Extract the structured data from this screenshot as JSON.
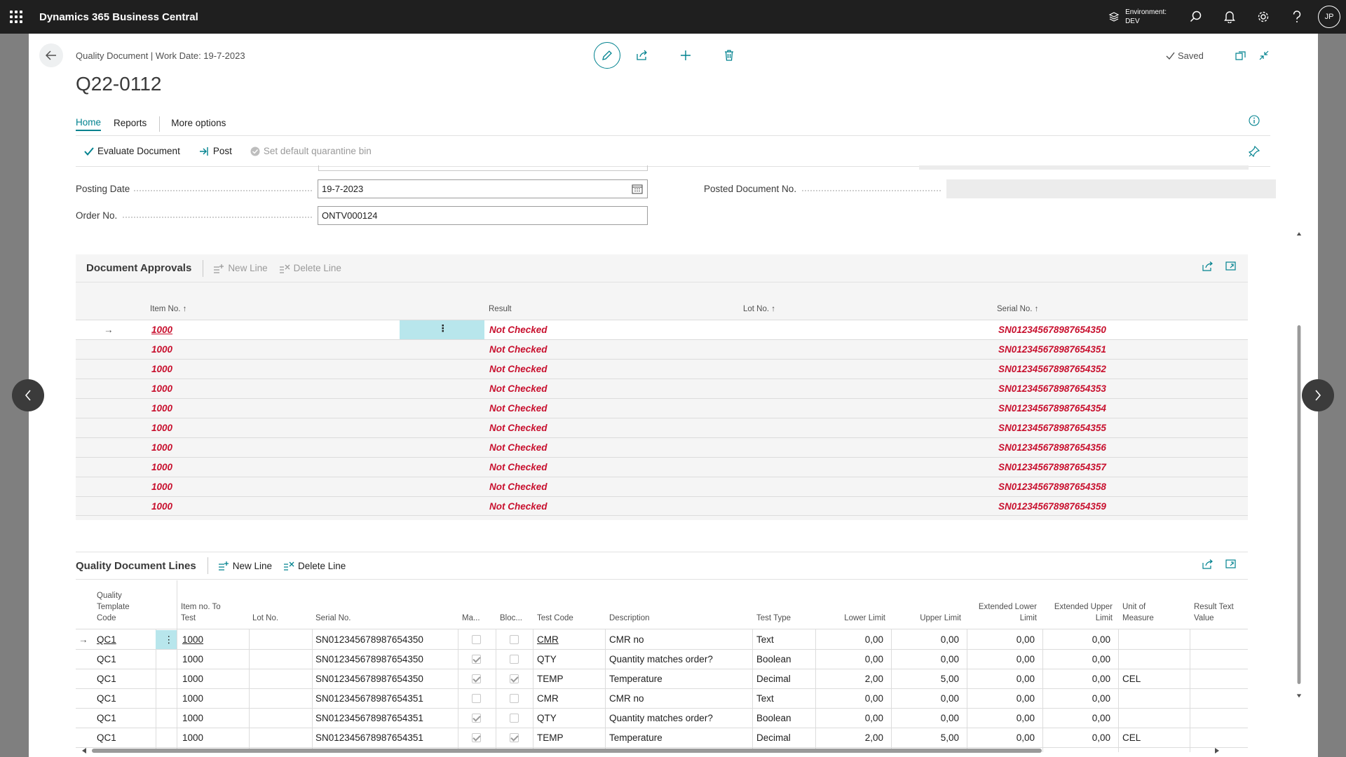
{
  "app": {
    "title": "Dynamics 365 Business Central",
    "environment_label": "Environment:",
    "environment_value": "DEV",
    "user_initials": "JP"
  },
  "page": {
    "breadcrumb": "Quality Document | Work Date: 19-7-2023",
    "title": "Q22-0112",
    "saved_label": "Saved",
    "tabs": [
      "Home",
      "Reports",
      "More options"
    ],
    "actions": {
      "evaluate": "Evaluate Document",
      "post": "Post",
      "quarantine": "Set default quarantine bin"
    }
  },
  "fields": {
    "posting_date_label": "Posting Date",
    "posting_date_value": "19-7-2023",
    "order_no_label": "Order No.",
    "order_no_value": "ONTV000124",
    "posted_doc_label": "Posted Document No.",
    "posted_doc_value": ""
  },
  "approvals": {
    "title": "Document Approvals",
    "new_line": "New Line",
    "delete_line": "Delete Line",
    "columns": [
      "Item No. ↑",
      "Result",
      "Lot No. ↑",
      "Serial No. ↑"
    ],
    "rows": [
      {
        "item": "1000",
        "result": "Not Checked",
        "lot": "",
        "serial": "SN01234567898765435O"
      },
      {
        "item": "1000",
        "result": "Not Checked",
        "lot": "",
        "serial": "SN01234567898765435​1"
      },
      {
        "item": "1000",
        "result": "Not Checked",
        "lot": "",
        "serial": "SN01234567898765435​2"
      },
      {
        "item": "1000",
        "result": "Not Checked",
        "lot": "",
        "serial": "SN01234567898765435​3"
      },
      {
        "item": "1000",
        "result": "Not Checked",
        "lot": "",
        "serial": "SN01234567898765435​4"
      },
      {
        "item": "1000",
        "result": "Not Checked",
        "lot": "",
        "serial": "SN01234567898765435​5"
      },
      {
        "item": "1000",
        "result": "Not Checked",
        "lot": "",
        "serial": "SN01234567898765435​6"
      },
      {
        "item": "1000",
        "result": "Not Checked",
        "lot": "",
        "serial": "SN01234567898765435​7"
      },
      {
        "item": "1000",
        "result": "Not Checked",
        "lot": "",
        "serial": "SN01234567898765435​8"
      },
      {
        "item": "1000",
        "result": "Not Checked",
        "lot": "",
        "serial": "SN01234567898765435​9"
      }
    ]
  },
  "lines": {
    "title": "Quality Document Lines",
    "new_line": "New Line",
    "delete_line": "Delete Line",
    "columns": {
      "template": [
        "Quality",
        "Template",
        "Code"
      ],
      "item": [
        "Item no. To",
        "Test"
      ],
      "lot": "Lot No.",
      "serial": "Serial No.",
      "ma": "Ma...",
      "bloc": "Bloc...",
      "test_code": "Test Code",
      "description": "Description",
      "test_type": "Test Type",
      "lower": "Lower Limit",
      "upper": "Upper Limit",
      "ext_lower": [
        "Extended Lower",
        "Limit"
      ],
      "ext_upper": [
        "Extended Upper",
        "Limit"
      ],
      "uom": [
        "Unit of",
        "Measure"
      ],
      "result_text": "Result Text Value"
    },
    "rows": [
      {
        "template": "QC1",
        "item": "1000",
        "lot": "",
        "serial": "SN012345678987654350",
        "ma": false,
        "bloc": false,
        "test_code": "CMR",
        "description": "CMR no",
        "test_type": "Text",
        "lower": "0,00",
        "upper": "0,00",
        "ext_lower": "0,00",
        "ext_upper": "0,00",
        "uom": "",
        "result_text": ""
      },
      {
        "template": "QC1",
        "item": "1000",
        "lot": "",
        "serial": "SN012345678987654350",
        "ma": true,
        "bloc": false,
        "test_code": "QTY",
        "description": "Quantity matches order?",
        "test_type": "Boolean",
        "lower": "0,00",
        "upper": "0,00",
        "ext_lower": "0,00",
        "ext_upper": "0,00",
        "uom": "",
        "result_text": ""
      },
      {
        "template": "QC1",
        "item": "1000",
        "lot": "",
        "serial": "SN012345678987654350",
        "ma": true,
        "bloc": true,
        "test_code": "TEMP",
        "description": "Temperature",
        "test_type": "Decimal",
        "lower": "2,00",
        "upper": "5,00",
        "ext_lower": "0,00",
        "ext_upper": "0,00",
        "uom": "CEL",
        "result_text": ""
      },
      {
        "template": "QC1",
        "item": "1000",
        "lot": "",
        "serial": "SN012345678987654351",
        "ma": false,
        "bloc": false,
        "test_code": "CMR",
        "description": "CMR no",
        "test_type": "Text",
        "lower": "0,00",
        "upper": "0,00",
        "ext_lower": "0,00",
        "ext_upper": "0,00",
        "uom": "",
        "result_text": ""
      },
      {
        "template": "QC1",
        "item": "1000",
        "lot": "",
        "serial": "SN012345678987654351",
        "ma": true,
        "bloc": false,
        "test_code": "QTY",
        "description": "Quantity matches order?",
        "test_type": "Boolean",
        "lower": "0,00",
        "upper": "0,00",
        "ext_lower": "0,00",
        "ext_upper": "0,00",
        "uom": "",
        "result_text": ""
      },
      {
        "template": "QC1",
        "item": "1000",
        "lot": "",
        "serial": "SN012345678987654351",
        "ma": true,
        "bloc": true,
        "test_code": "TEMP",
        "description": "Temperature",
        "test_type": "Decimal",
        "lower": "2,00",
        "upper": "5,00",
        "ext_lower": "0,00",
        "ext_upper": "0,00",
        "uom": "CEL",
        "result_text": ""
      }
    ]
  },
  "colors": {
    "accent": "#00828f",
    "error_red": "#c8102e",
    "appbar": "#1f1f1f"
  }
}
